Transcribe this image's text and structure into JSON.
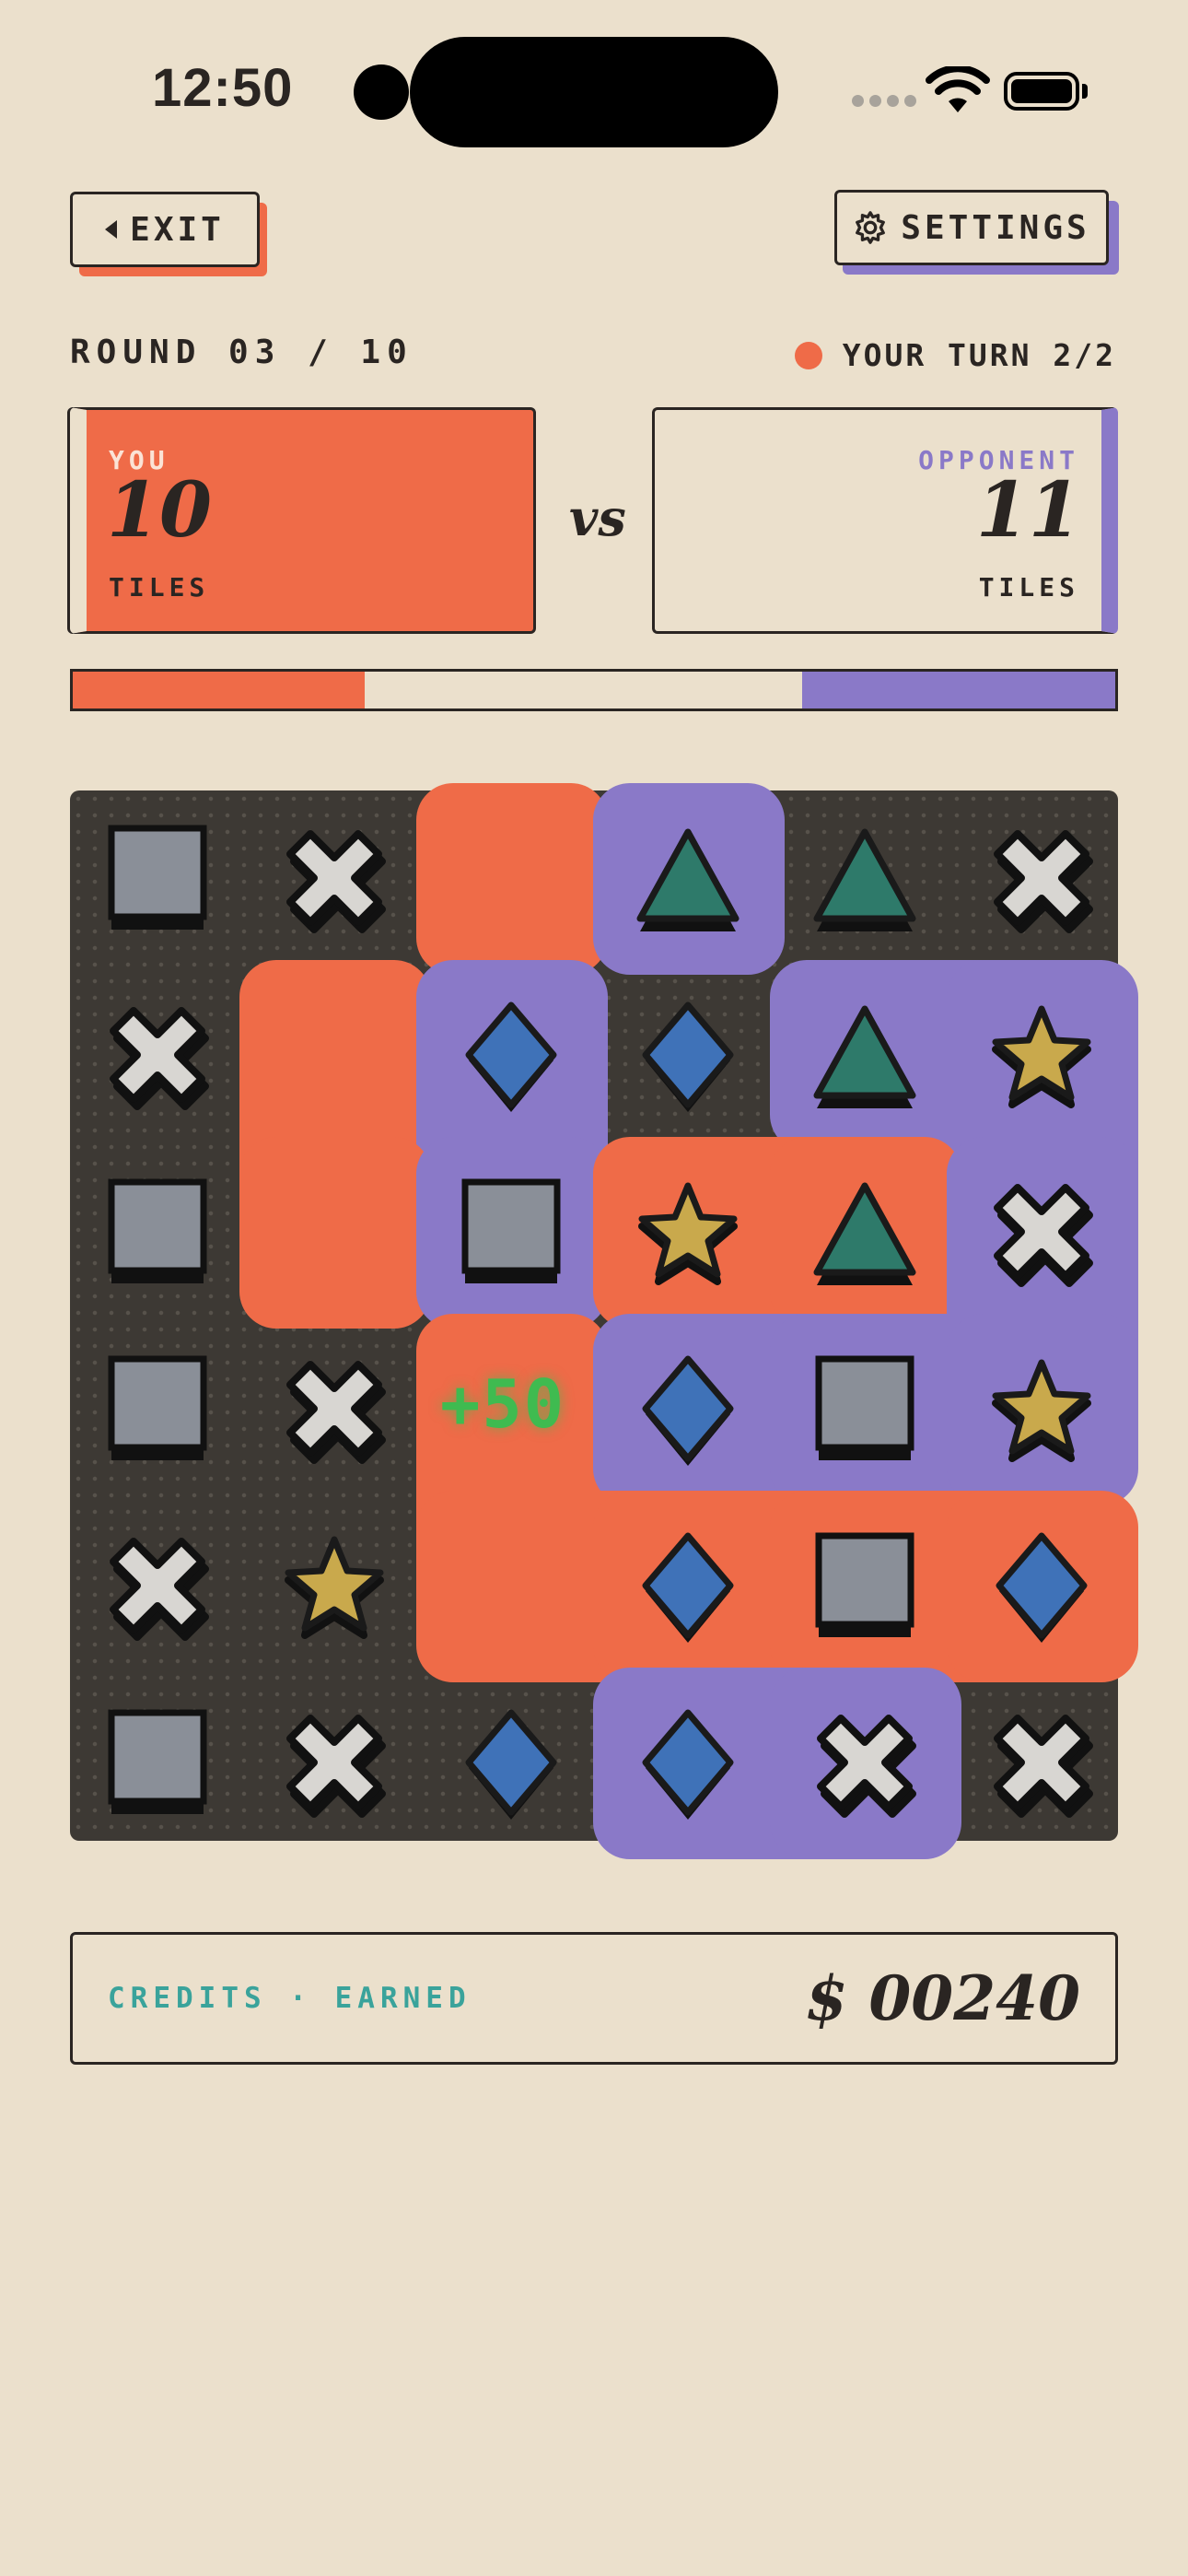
{
  "status_bar": {
    "time": "12:50"
  },
  "header": {
    "exit_label": "EXIT",
    "settings_label": "SETTINGS"
  },
  "round": {
    "label": "ROUND 03 / 10"
  },
  "turn": {
    "label": "YOUR TURN 2/2"
  },
  "players": {
    "you": {
      "name": "YOU",
      "score": "10",
      "unit": "TILES"
    },
    "opponent": {
      "name": "OPPONENT",
      "score": "11",
      "unit": "TILES"
    },
    "vs_label": "vs"
  },
  "progress": {
    "you_fraction": 0.28,
    "opponent_fraction": 0.3
  },
  "colors": {
    "you": "#ef6b48",
    "opponent": "#8a79c8",
    "board": "#3d3934",
    "points": "#3fbb50"
  },
  "board": {
    "rows": [
      [
        "square",
        "x",
        "",
        "triangle",
        "triangle",
        "x"
      ],
      [
        "x",
        "",
        "diamond",
        "diamond",
        "triangle",
        "star"
      ],
      [
        "square",
        "",
        "square",
        "star",
        "triangle",
        "x"
      ],
      [
        "square",
        "x",
        "",
        "diamond",
        "square",
        "star"
      ],
      [
        "x",
        "star",
        "",
        "diamond",
        "square",
        "diamond"
      ],
      [
        "square",
        "x",
        "diamond",
        "diamond",
        "x",
        "x"
      ]
    ],
    "owners": [
      [
        "",
        "",
        "you",
        "opponent",
        "",
        ""
      ],
      [
        "",
        "you",
        "opponent",
        "",
        "opponent",
        "opponent"
      ],
      [
        "",
        "you",
        "opponent",
        "you",
        "you",
        "opponent"
      ],
      [
        "",
        "",
        "you",
        "opponent",
        "opponent",
        "opponent"
      ],
      [
        "",
        "",
        "you",
        "you",
        "you",
        "you"
      ],
      [
        "",
        "",
        "",
        "opponent",
        "opponent",
        ""
      ]
    ],
    "points_popup": {
      "text": "+50",
      "row": 3,
      "col": 2
    }
  },
  "credits": {
    "label": "CREDITS · EARNED",
    "value": "$ 00240"
  }
}
